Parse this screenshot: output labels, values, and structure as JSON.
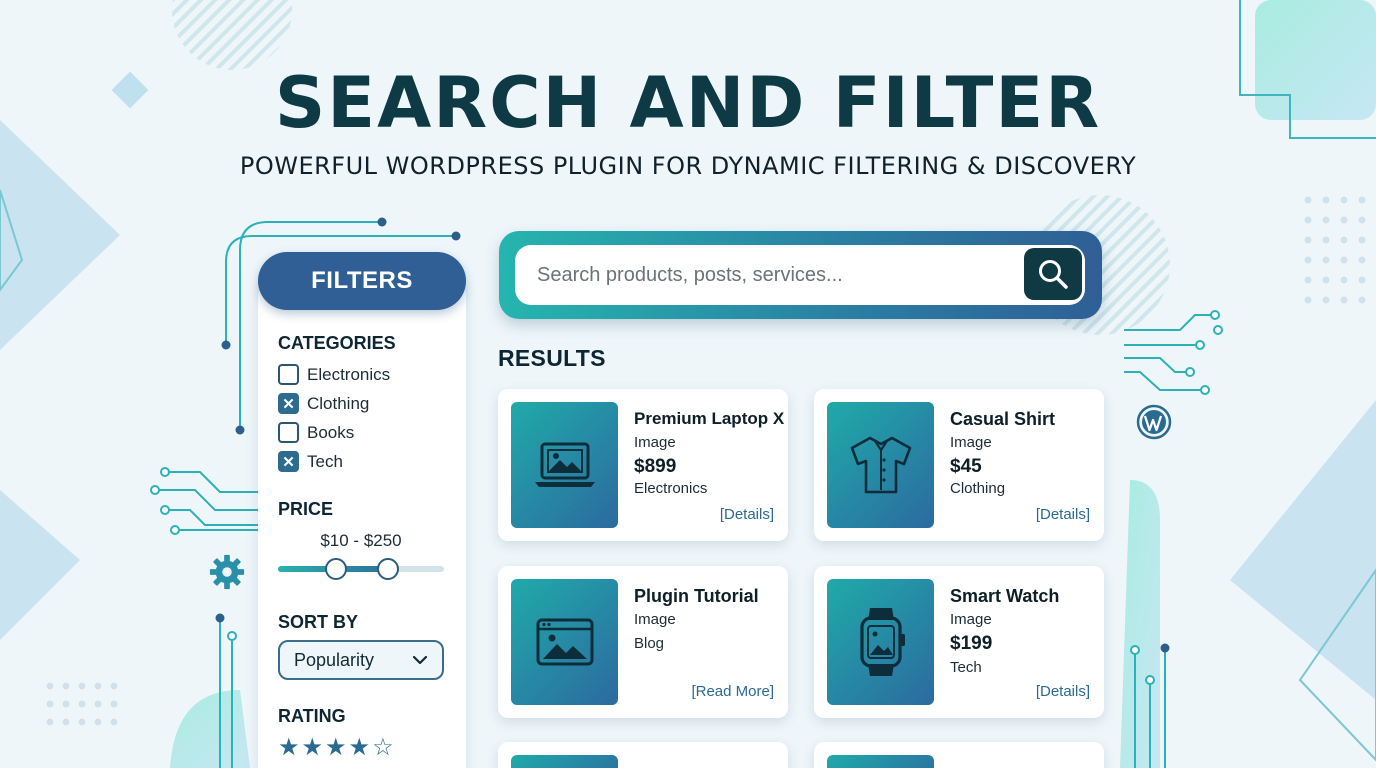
{
  "header": {
    "title": "SEARCH AND FILTER",
    "subtitle": "POWERFUL WORDPRESS PLUGIN FOR DYNAMIC FILTERING & DISCOVERY"
  },
  "filters": {
    "heading": "FILTERS",
    "categories_label": "CATEGORIES",
    "categories": [
      {
        "label": "Electronics",
        "checked": false
      },
      {
        "label": "Clothing",
        "checked": true
      },
      {
        "label": "Books",
        "checked": false
      },
      {
        "label": "Tech",
        "checked": true
      }
    ],
    "price_label": "PRICE",
    "price_range_text": "$10 - $250",
    "price_slider": {
      "low_fraction": 0.35,
      "high_fraction": 0.66
    },
    "sort_label": "SORT BY",
    "sort_value": "Popularity",
    "rating_label": "RATING",
    "rating": {
      "filled": 4,
      "total": 5
    }
  },
  "search": {
    "placeholder": "Search products, posts, services...",
    "button_icon": "search-icon"
  },
  "results": {
    "heading": "RESULTS",
    "cards": [
      {
        "title": "Premium Laptop X",
        "type": "Image",
        "price": "$899",
        "category": "Electronics",
        "link": "[Details]",
        "icon": "laptop-icon"
      },
      {
        "title": "Casual Shirt",
        "type": "Image",
        "price": "$45",
        "category": "Clothing",
        "link": "[Details]",
        "icon": "shirt-icon"
      },
      {
        "title": "Plugin Tutorial",
        "type": "Image",
        "price": "",
        "category": "Blog",
        "link": "[Read More]",
        "icon": "browser-image-icon"
      },
      {
        "title": "Smart Watch",
        "type": "Image",
        "price": "$199",
        "category": "Tech",
        "link": "[Details]",
        "icon": "smartwatch-icon"
      }
    ]
  },
  "colors": {
    "brand_dark": "#0d3a44",
    "brand_blue": "#2f5f95",
    "accent_teal": "#26b5ae",
    "background": "#eef6fa"
  }
}
